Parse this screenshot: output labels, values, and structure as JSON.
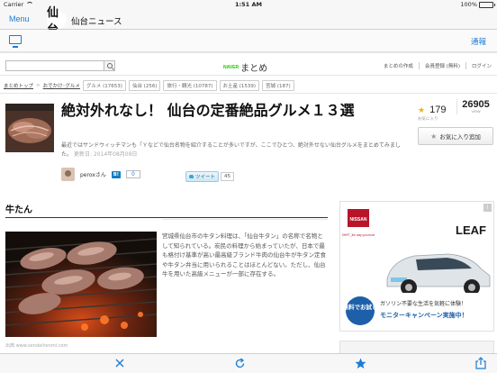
{
  "status_bar": {
    "carrier": "Carrier",
    "time": "1:51 AM",
    "battery": "100%",
    "battery_level": 1.0
  },
  "app_header": {
    "menu_label": "Menu",
    "logo_glyph": "仙台",
    "title": "仙台ニュース"
  },
  "sub_bar": {
    "notify_label": "通報"
  },
  "site": {
    "logo_naver": "NAVER",
    "logo_matome": "まとめ",
    "links": [
      "まとめの作成",
      "会員登録 (無料)",
      "ログイン"
    ]
  },
  "breadcrumbs": {
    "items": [
      "まとめトップ",
      "おでかけ･グルメ"
    ],
    "tags": [
      "グルメ (17653)",
      "仙台 (256)",
      "旅行・観光 (10787)",
      "お土産 (1539)",
      "宮城 (187)"
    ]
  },
  "article": {
    "title": "絶対外れなし！ 仙台の定番絶品グルメ１３選",
    "description": "最近ではサンドウィッチマンも「Ｙなどで仙台名物を紹介することが多いですが、ここでひとつ、絶対外せない仙台グルメをまとめてみました。",
    "date": "更新日: 2014年08月09日",
    "favorites": "179",
    "favorites_label": "お気に入り",
    "views": "26905",
    "views_label": "view",
    "fav_button": "お気に入り追加",
    "author": "perox",
    "author_suffix": "さん",
    "hatena_label": "B!",
    "hatena_count": "0",
    "tweet_label": "ツイート",
    "tweet_count": "45"
  },
  "section": {
    "heading": "牛たん",
    "text": "宮城県仙台市の牛タン料理は、「仙台牛タン」の名称で名物として知られている。炭民の料理から始まっていたが、日本で最も格付け基準が高い最高級ブランド牛肉の仙台牛が牛タン定食や牛タン弁当に用いられることはほとんどない。ただし、仙台牛を用いた高級メニューが一部に存在する。",
    "credit": "出典 www.sendaihenmi.com"
  },
  "ad": {
    "brand": "NISSAN",
    "tagline": "SHIFT_the way you move",
    "model": "LEAF",
    "promo_badge": "無料でお試し",
    "promo_line1": "ガソリン不要な生活を気軽に体験！",
    "promo_line2": "モニターキャンペーン実施中！",
    "info_glyph": "i"
  },
  "toolbar": {
    "close_glyph": "✕",
    "reload_glyph": "↻",
    "star_glyph": "★",
    "share_glyph": "⇪"
  },
  "colors": {
    "ios_blue": "#1e7bd6",
    "naver_green": "#1ec800",
    "star_yellow": "#f5b400",
    "ad_blue": "#1d5fa8"
  }
}
